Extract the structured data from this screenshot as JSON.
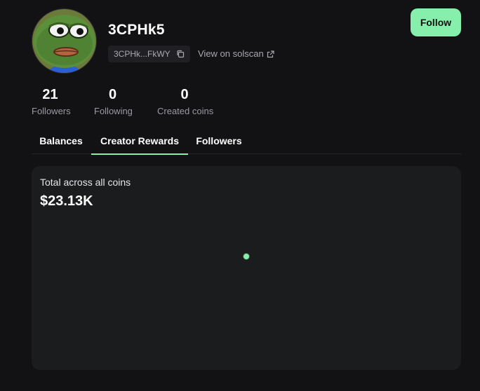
{
  "profile": {
    "username": "3CPHk5",
    "address_short": "3CPHk...FkWY",
    "solscan_label": "View on solscan",
    "follow_label": "Follow"
  },
  "stats": [
    {
      "value": "21",
      "label": "Followers"
    },
    {
      "value": "0",
      "label": "Following"
    },
    {
      "value": "0",
      "label": "Created coins"
    }
  ],
  "tabs": [
    {
      "label": "Balances",
      "active": false
    },
    {
      "label": "Creator Rewards",
      "active": true
    },
    {
      "label": "Followers",
      "active": false
    }
  ],
  "rewards": {
    "label": "Total across all coins",
    "total": "$23.13K"
  },
  "colors": {
    "accent": "#86efac",
    "background": "#121214",
    "card": "#1b1c1e"
  },
  "icons": {
    "copy": "copy-icon",
    "external": "external-link-icon",
    "avatar": "frog-avatar"
  }
}
